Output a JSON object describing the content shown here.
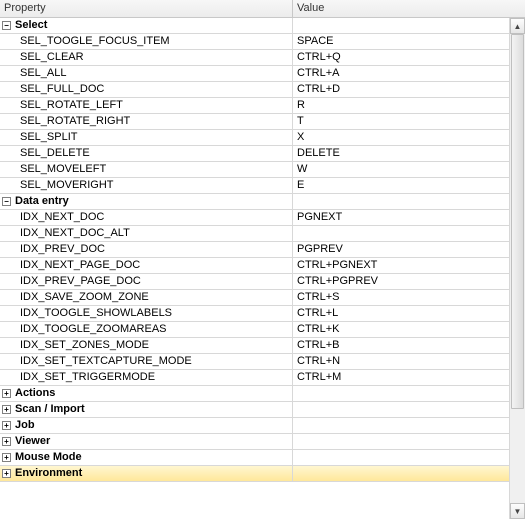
{
  "header": {
    "property": "Property",
    "value": "Value"
  },
  "groups": [
    {
      "name": "Select",
      "expanded": true,
      "items": [
        {
          "prop": "SEL_TOOGLE_FOCUS_ITEM",
          "val": "SPACE"
        },
        {
          "prop": "SEL_CLEAR",
          "val": "CTRL+Q"
        },
        {
          "prop": "SEL_ALL",
          "val": "CTRL+A"
        },
        {
          "prop": "SEL_FULL_DOC",
          "val": "CTRL+D"
        },
        {
          "prop": "SEL_ROTATE_LEFT",
          "val": "R"
        },
        {
          "prop": "SEL_ROTATE_RIGHT",
          "val": "T"
        },
        {
          "prop": "SEL_SPLIT",
          "val": "X"
        },
        {
          "prop": "SEL_DELETE",
          "val": "DELETE"
        },
        {
          "prop": "SEL_MOVELEFT",
          "val": "W"
        },
        {
          "prop": "SEL_MOVERIGHT",
          "val": "E"
        }
      ]
    },
    {
      "name": "Data entry",
      "expanded": true,
      "items": [
        {
          "prop": "IDX_NEXT_DOC",
          "val": "PGNEXT"
        },
        {
          "prop": "IDX_NEXT_DOC_ALT",
          "val": ""
        },
        {
          "prop": "IDX_PREV_DOC",
          "val": "PGPREV"
        },
        {
          "prop": "IDX_NEXT_PAGE_DOC",
          "val": "CTRL+PGNEXT"
        },
        {
          "prop": "IDX_PREV_PAGE_DOC",
          "val": "CTRL+PGPREV"
        },
        {
          "prop": "IDX_SAVE_ZOOM_ZONE",
          "val": "CTRL+S"
        },
        {
          "prop": "IDX_TOOGLE_SHOWLABELS",
          "val": "CTRL+L"
        },
        {
          "prop": "IDX_TOOGLE_ZOOMAREAS",
          "val": "CTRL+K"
        },
        {
          "prop": "IDX_SET_ZONES_MODE",
          "val": "CTRL+B"
        },
        {
          "prop": "IDX_SET_TEXTCAPTURE_MODE",
          "val": "CTRL+N"
        },
        {
          "prop": "IDX_SET_TRIGGERMODE",
          "val": "CTRL+M"
        }
      ]
    },
    {
      "name": "Actions",
      "expanded": false,
      "items": []
    },
    {
      "name": "Scan / Import",
      "expanded": false,
      "items": []
    },
    {
      "name": "Job",
      "expanded": false,
      "items": []
    },
    {
      "name": "Viewer",
      "expanded": false,
      "items": []
    },
    {
      "name": "Mouse Mode",
      "expanded": false,
      "items": []
    },
    {
      "name": "Environment",
      "expanded": false,
      "items": [],
      "selected": true
    }
  ]
}
